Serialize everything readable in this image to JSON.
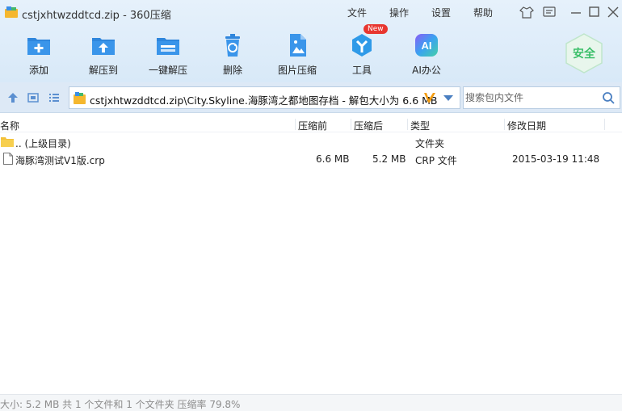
{
  "window": {
    "title": "cstjxhtwzddtcd.zip - 360压缩"
  },
  "menu": [
    "文件",
    "操作",
    "设置",
    "帮助"
  ],
  "toolbar": [
    {
      "label": "添加",
      "icon": "add-icon"
    },
    {
      "label": "解压到",
      "icon": "extract-to-icon"
    },
    {
      "label": "一键解压",
      "icon": "one-click-extract-icon"
    },
    {
      "label": "删除",
      "icon": "delete-icon"
    },
    {
      "label": "图片压缩",
      "icon": "image-compress-icon"
    },
    {
      "label": "工具",
      "icon": "tools-icon",
      "badge": "New"
    },
    {
      "label": "AI办公",
      "icon": "ai-office-icon",
      "icon_text": "AI"
    }
  ],
  "security": {
    "label": "安全"
  },
  "address": {
    "path": "cstjxhtwzddtcd.zip\\City.Skyline.海豚湾之都地图存档 - 解包大小为 6.6 MB"
  },
  "search": {
    "placeholder": "搜索包内文件"
  },
  "columns": {
    "name": "名称",
    "compressed": "压缩前",
    "packed": "压缩后",
    "type": "类型",
    "modified": "修改日期"
  },
  "rows": [
    {
      "name": ".. (上级目录)",
      "size": "",
      "packed": "",
      "type": "文件夹",
      "modified": "",
      "icon": "folder-icon"
    },
    {
      "name": "海豚湾测试V1版.crp",
      "size": "6.6 MB",
      "packed": "5.2 MB",
      "type": "CRP 文件",
      "modified": "2015-03-19 11:48",
      "icon": "file-icon"
    }
  ],
  "status": {
    "text": "大小: 5.2 MB 共 1 个文件和 1 个文件夹 压缩率 79.8%"
  },
  "colors": {
    "accent": "#3a8ee6",
    "title_bg": "#e6f1fb",
    "safe_green": "#3cbf6a"
  }
}
